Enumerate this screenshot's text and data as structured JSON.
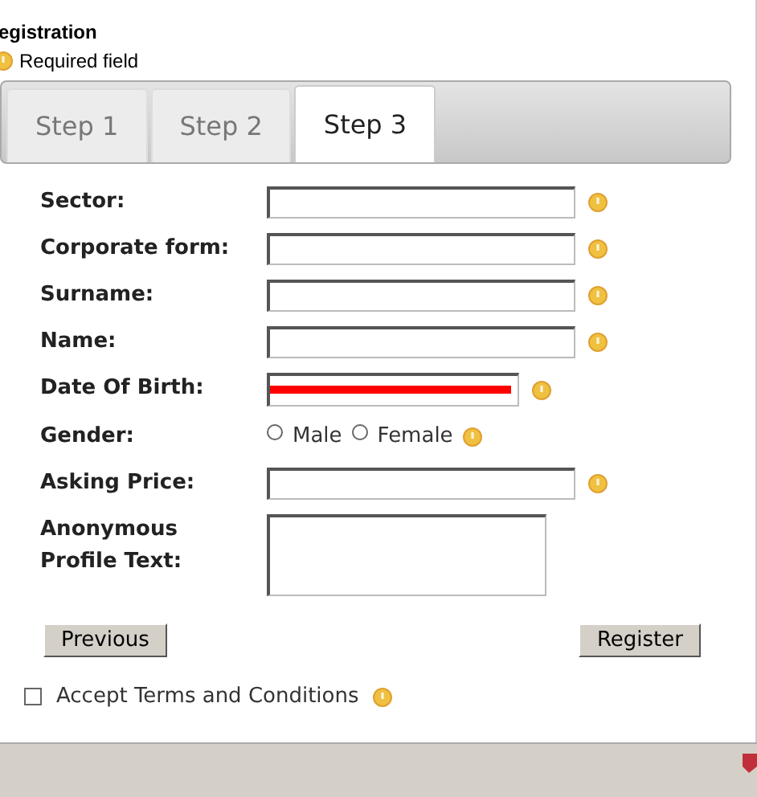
{
  "header": {
    "title": "egistration",
    "legend": "Required field"
  },
  "tabs": [
    {
      "label": "Step 1",
      "selected": false
    },
    {
      "label": "Step 2",
      "selected": false
    },
    {
      "label": "Step 3",
      "selected": true
    }
  ],
  "fields": [
    {
      "kind": "text",
      "label": "Sector:",
      "required": true
    },
    {
      "kind": "text",
      "label": "Corporate form:",
      "required": true
    },
    {
      "kind": "text",
      "label": "Surname:",
      "required": true
    },
    {
      "kind": "text",
      "label": "Name:",
      "required": true
    },
    {
      "kind": "redacted",
      "label": "Date Of Birth:",
      "required": true
    },
    {
      "kind": "radio",
      "label": "Gender:",
      "required": true,
      "options": [
        {
          "label": "Male",
          "selected": false
        },
        {
          "label": "Female",
          "selected": false
        }
      ]
    },
    {
      "kind": "text",
      "label": "Asking Price:",
      "required": true
    },
    {
      "kind": "textarea",
      "label": "Anonymous Profile Text:",
      "required": false
    }
  ],
  "buttons": {
    "previous": "Previous",
    "register": "Register"
  },
  "terms": {
    "label": "Accept Terms and Conditions",
    "checked": false,
    "required": true
  }
}
